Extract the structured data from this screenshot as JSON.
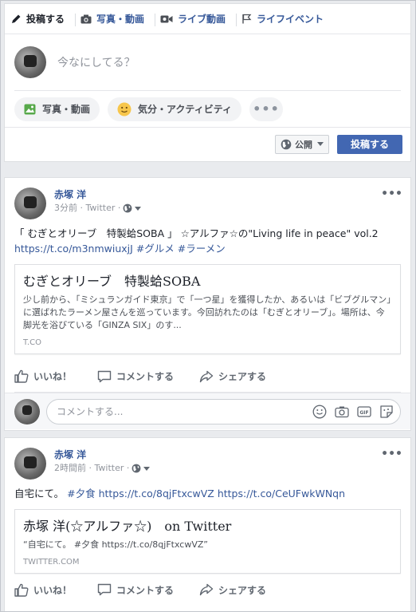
{
  "composer": {
    "tabs": [
      {
        "label": "投稿する",
        "icon": "pencil-icon"
      },
      {
        "label": "写真・動画",
        "icon": "camera-icon"
      },
      {
        "label": "ライブ動画",
        "icon": "video-camera-icon"
      },
      {
        "label": "ライフイベント",
        "icon": "flag-icon"
      }
    ],
    "placeholder": "今なにしてる？",
    "actions": [
      {
        "label": "写真・動画",
        "icon": "photo-icon"
      },
      {
        "label": "気分・アクティビティ",
        "icon": "smiley-icon"
      },
      {
        "label": "•••",
        "icon": "more-icon"
      }
    ],
    "privacy_label": "公開",
    "post_label": "投稿する"
  },
  "posts": [
    {
      "author": "赤塚 洋",
      "time": "3分前",
      "source": "Twitter",
      "text_prefix": "「 むぎとオリーブ　特製蛤SOBA 」 ☆アルファ☆の\"Living life in peace\" vol.2 ",
      "link_url": "https://t.co/m3nmwiuxjJ",
      "hashtag1": "#グルメ",
      "hashtag2": "#ラーメン",
      "card": {
        "title": "むぎとオリーブ　特製蛤SOBA",
        "desc": "少し前から、「ミシュランガイド東京」で「一つ星」を獲得したか、あるいは「ビブグルマン」に選ばれたラーメン屋さんを巡っています。今回訪れたのは「むぎとオリーブ」。場所は、今脚光を浴びている「GINZA SIX」のす...",
        "source": "T.CO"
      },
      "like_label": "いいね！",
      "comment_label": "コメントする",
      "share_label": "シェアする",
      "comment_placeholder": "コメントする..."
    },
    {
      "author": "赤塚 洋",
      "time": "2時間前",
      "source": "Twitter",
      "text_prefix": "自宅にて。 ",
      "hashtag1": "#夕食",
      "link1": "https://t.co/8qjFtxcwVZ",
      "link2": "https://t.co/CeUFwkWNqn",
      "card": {
        "title": "赤塚 洋(☆アルファ☆)　on Twitter",
        "desc": "“自宅にて。 #夕食 https://t.co/8qjFtxcwVZ”",
        "source": "TWITTER.COM"
      },
      "like_label": "いいね！",
      "comment_label": "コメントする",
      "share_label": "シェアする"
    }
  ],
  "colors": {
    "brand_blue": "#4267b2",
    "link_blue": "#365899",
    "background": "#e9ebee"
  }
}
